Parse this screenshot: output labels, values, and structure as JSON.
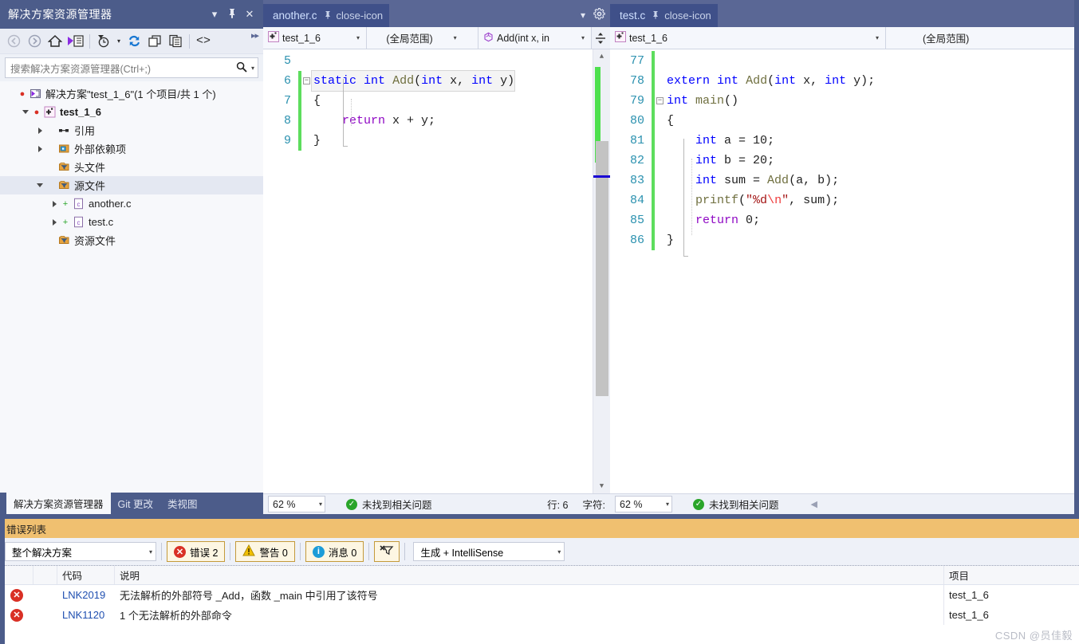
{
  "solution_explorer": {
    "title": "解决方案资源管理器",
    "window_controls": [
      "▾",
      "⇱",
      "✕"
    ],
    "toolbar_icons": [
      "back-arrow",
      "forward-arrow",
      "home",
      "sync-with-active-document",
      "pending-changes-filter",
      "refresh",
      "collapse-all",
      "properties",
      "show-all-files",
      "overflow"
    ],
    "search": {
      "placeholder": "搜索解决方案资源管理器(Ctrl+;)",
      "search_icon": "search-icon",
      "caret": "▾"
    },
    "tree": [
      {
        "label": "解决方案\"test_1_6\"(1 个项目/共 1 个)",
        "indent": 0,
        "twisty": "none",
        "icon": "solution-icon",
        "bold": false,
        "selected": false,
        "status": "●"
      },
      {
        "label": "test_1_6",
        "indent": 1,
        "twisty": "down",
        "icon": "project-icon",
        "bold": true,
        "selected": false,
        "status": "●"
      },
      {
        "label": "引用",
        "indent": 2,
        "twisty": "right",
        "icon": "references-icon",
        "bold": false,
        "selected": false,
        "status": ""
      },
      {
        "label": "外部依赖项",
        "indent": 2,
        "twisty": "right",
        "icon": "external-deps-icon",
        "bold": false,
        "selected": false,
        "status": ""
      },
      {
        "label": "头文件",
        "indent": 2,
        "twisty": "none",
        "icon": "filter-folder-icon",
        "bold": false,
        "selected": false,
        "status": ""
      },
      {
        "label": "源文件",
        "indent": 2,
        "twisty": "down",
        "icon": "filter-folder-icon",
        "bold": false,
        "selected": true,
        "status": ""
      },
      {
        "label": "another.c",
        "indent": 3,
        "twisty": "right",
        "icon": "c-file-icon",
        "bold": false,
        "selected": false,
        "status": "+"
      },
      {
        "label": "test.c",
        "indent": 3,
        "twisty": "right",
        "icon": "c-file-icon",
        "bold": false,
        "selected": false,
        "status": "+"
      },
      {
        "label": "资源文件",
        "indent": 2,
        "twisty": "none",
        "icon": "filter-folder-icon",
        "bold": false,
        "selected": false,
        "status": ""
      }
    ],
    "bottom_tabs": [
      {
        "label": "解决方案资源管理器",
        "active": true
      },
      {
        "label": "Git 更改",
        "active": false
      },
      {
        "label": "类视图",
        "active": false
      }
    ]
  },
  "editor_left": {
    "tab": {
      "name": "another.c",
      "pin_icon": "pin-icon",
      "close_icon": "close-icon"
    },
    "tabstrip_controls": [
      "▾",
      "⚙"
    ],
    "navbar": {
      "project": "test_1_6",
      "project_icon": "project-icon",
      "scope": "(全局范围)",
      "member": "Add(int x, in",
      "member_icon": "method-icon",
      "split_icon": "split-view-icon"
    },
    "lines": [
      {
        "num": "5",
        "changed": false,
        "fold": "",
        "highlight": false,
        "tokens": []
      },
      {
        "num": "6",
        "changed": true,
        "fold": "−",
        "highlight": true,
        "tokens": [
          {
            "t": "static",
            "c": "kw"
          },
          {
            "t": " ",
            "c": "pl"
          },
          {
            "t": "int",
            "c": "kw"
          },
          {
            "t": " ",
            "c": "pl"
          },
          {
            "t": "Add",
            "c": "fn"
          },
          {
            "t": "(",
            "c": "pl"
          },
          {
            "t": "int",
            "c": "kw"
          },
          {
            "t": " x, ",
            "c": "pl"
          },
          {
            "t": "int",
            "c": "kw"
          },
          {
            "t": " y)",
            "c": "pl"
          }
        ]
      },
      {
        "num": "7",
        "changed": true,
        "fold": "",
        "highlight": false,
        "tokens": [
          {
            "t": "{",
            "c": "pl"
          }
        ]
      },
      {
        "num": "8",
        "changed": true,
        "fold": "",
        "highlight": false,
        "tokens": [
          {
            "t": "    ",
            "c": "pl"
          },
          {
            "t": "return",
            "c": "ctl"
          },
          {
            "t": " x + y;",
            "c": "pl"
          }
        ]
      },
      {
        "num": "9",
        "changed": true,
        "fold": "",
        "highlight": false,
        "tokens": [
          {
            "t": "}",
            "c": "pl"
          }
        ]
      }
    ],
    "status": {
      "zoom": "62 %",
      "zoom_caret": "▾",
      "ok_icon": "check-circle-icon",
      "message": "未找到相关问题",
      "line_label": "行: 6",
      "char_label": "字符:"
    }
  },
  "editor_right": {
    "tab": {
      "name": "test.c",
      "pin_icon": "pin-icon",
      "close_icon": "close-icon"
    },
    "navbar": {
      "project": "test_1_6",
      "project_icon": "project-icon",
      "scope": "(全局范围)"
    },
    "lines": [
      {
        "num": "77",
        "changed": true,
        "fold": "",
        "highlight": false,
        "tokens": []
      },
      {
        "num": "78",
        "changed": true,
        "fold": "",
        "highlight": false,
        "tokens": [
          {
            "t": "extern",
            "c": "kw"
          },
          {
            "t": " ",
            "c": "pl"
          },
          {
            "t": "int",
            "c": "kw"
          },
          {
            "t": " ",
            "c": "pl"
          },
          {
            "t": "Add",
            "c": "fn"
          },
          {
            "t": "(",
            "c": "pl"
          },
          {
            "t": "int",
            "c": "kw"
          },
          {
            "t": " x, ",
            "c": "pl"
          },
          {
            "t": "int",
            "c": "kw"
          },
          {
            "t": " y);",
            "c": "pl"
          }
        ]
      },
      {
        "num": "79",
        "changed": true,
        "fold": "−",
        "highlight": false,
        "tokens": [
          {
            "t": "int",
            "c": "kw"
          },
          {
            "t": " ",
            "c": "pl"
          },
          {
            "t": "main",
            "c": "fn"
          },
          {
            "t": "()",
            "c": "pl"
          }
        ]
      },
      {
        "num": "80",
        "changed": true,
        "fold": "",
        "highlight": false,
        "tokens": [
          {
            "t": "{",
            "c": "pl"
          }
        ]
      },
      {
        "num": "81",
        "changed": true,
        "fold": "",
        "highlight": false,
        "tokens": [
          {
            "t": "    ",
            "c": "pl"
          },
          {
            "t": "int",
            "c": "kw"
          },
          {
            "t": " a = ",
            "c": "pl"
          },
          {
            "t": "10",
            "c": "num"
          },
          {
            "t": ";",
            "c": "pl"
          }
        ]
      },
      {
        "num": "82",
        "changed": true,
        "fold": "",
        "highlight": false,
        "tokens": [
          {
            "t": "    ",
            "c": "pl"
          },
          {
            "t": "int",
            "c": "kw"
          },
          {
            "t": " b = ",
            "c": "pl"
          },
          {
            "t": "20",
            "c": "num"
          },
          {
            "t": ";",
            "c": "pl"
          }
        ]
      },
      {
        "num": "83",
        "changed": true,
        "fold": "",
        "highlight": false,
        "tokens": [
          {
            "t": "    ",
            "c": "pl"
          },
          {
            "t": "int",
            "c": "kw"
          },
          {
            "t": " sum = ",
            "c": "pl"
          },
          {
            "t": "Add",
            "c": "fn"
          },
          {
            "t": "(a, b);",
            "c": "pl"
          }
        ]
      },
      {
        "num": "84",
        "changed": true,
        "fold": "",
        "highlight": false,
        "tokens": [
          {
            "t": "    ",
            "c": "pl"
          },
          {
            "t": "printf",
            "c": "fn"
          },
          {
            "t": "(",
            "c": "pl"
          },
          {
            "t": "\"%d",
            "c": "str"
          },
          {
            "t": "\\n",
            "c": "esc"
          },
          {
            "t": "\"",
            "c": "str"
          },
          {
            "t": ", sum);",
            "c": "pl"
          }
        ]
      },
      {
        "num": "85",
        "changed": true,
        "fold": "",
        "highlight": false,
        "tokens": [
          {
            "t": "    ",
            "c": "pl"
          },
          {
            "t": "return",
            "c": "ctl"
          },
          {
            "t": " ",
            "c": "pl"
          },
          {
            "t": "0",
            "c": "num"
          },
          {
            "t": ";",
            "c": "pl"
          }
        ]
      },
      {
        "num": "86",
        "changed": true,
        "fold": "",
        "highlight": false,
        "tokens": [
          {
            "t": "}",
            "c": "pl"
          }
        ]
      }
    ],
    "status": {
      "zoom": "62 %",
      "zoom_caret": "▾",
      "ok_icon": "check-circle-icon",
      "message": "未找到相关问题",
      "collapse_icon": "◀"
    }
  },
  "error_list": {
    "title": "错误列表",
    "scope_filter": {
      "value": "整个解决方案",
      "caret": "▾"
    },
    "severity_buttons": [
      {
        "icon": "error-icon",
        "label": "错误 2"
      },
      {
        "icon": "warning-icon",
        "label": "警告 0"
      },
      {
        "icon": "info-icon",
        "label": "消息 0"
      }
    ],
    "clear_filter_icon": "clear-filter-icon",
    "build_filter": {
      "value": "生成 + IntelliSense",
      "caret": "▾"
    },
    "columns": [
      "",
      "",
      "代码",
      "说明",
      "项目"
    ],
    "rows": [
      {
        "icon": "error-icon",
        "code": "LNK2019",
        "description": "无法解析的外部符号 _Add，函数 _main 中引用了该符号",
        "project": "test_1_6"
      },
      {
        "icon": "error-icon",
        "code": "LNK1120",
        "description": "1 个无法解析的外部命令",
        "project": "test_1_6"
      }
    ]
  },
  "watermark": "CSDN @员佳毅",
  "theme": {
    "chrome_blue": "#4c5c8a",
    "tabstrip_blue": "#5a6795",
    "active_tab_blue": "#3f5089",
    "panel_bg": "#eef1f8",
    "error_title_bg": "#f0c070",
    "change_bar_green": "#5ddd5d",
    "error_red": "#d93025",
    "link_blue": "#1f4fb0"
  }
}
